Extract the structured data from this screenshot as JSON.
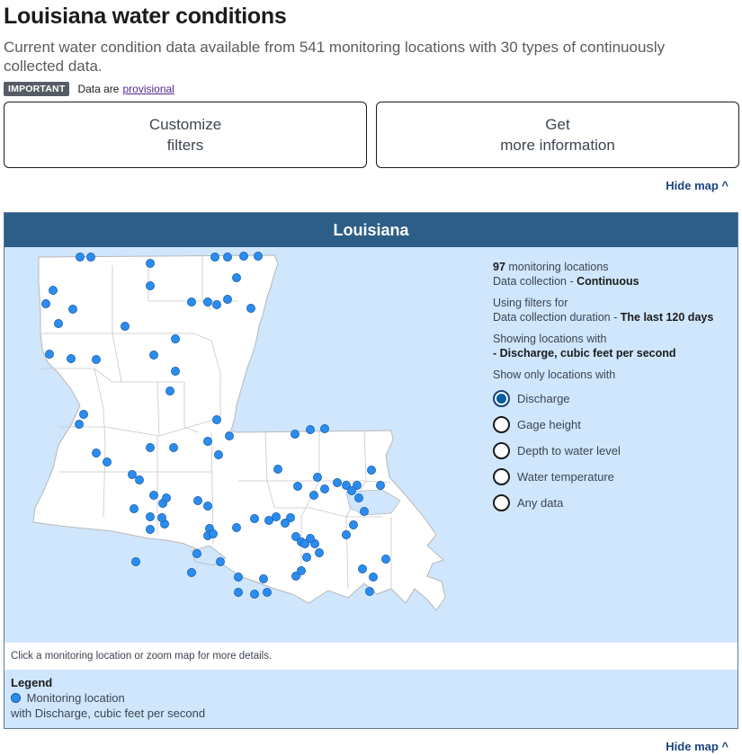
{
  "page": {
    "title": "Louisiana water conditions",
    "subtitle": "Current water condition data available from 541 monitoring locations with 30 types of continuously collected data.",
    "important_badge": "IMPORTANT",
    "important_text": "Data are",
    "important_link": "provisional"
  },
  "buttons": {
    "customize_line1": "Customize",
    "customize_line2": "filters",
    "info_line1": "Get",
    "info_line2": "more information"
  },
  "hide_map_label": "Hide map ^",
  "map": {
    "header": "Louisiana",
    "location_count": "97",
    "location_count_suffix": "monitoring locations",
    "collection_label": "Data collection -",
    "collection_value": "Continuous",
    "filters_label": "Using filters for",
    "duration_label": "Data collection duration -",
    "duration_value": "The last 120 days",
    "showing_label": "Showing locations with",
    "showing_value": "- Discharge, cubic feet per second",
    "show_only_label": "Show only locations with",
    "options": [
      {
        "label": "Discharge",
        "checked": true
      },
      {
        "label": "Gage height",
        "checked": false
      },
      {
        "label": "Depth to water level",
        "checked": false
      },
      {
        "label": "Water temperature",
        "checked": false
      },
      {
        "label": "Any data",
        "checked": false
      }
    ],
    "hint": "Click a monitoring location or zoom map for more details.",
    "legend_title": "Legend",
    "legend_item": "Monitoring location",
    "legend_item_detail": "with Discharge, cubic feet per second",
    "colors": {
      "water": "#cfe6fd",
      "land": "#ffffff",
      "marker": "#2a8cf0",
      "header": "#2c5e87"
    },
    "marker_count_shown": 97
  }
}
